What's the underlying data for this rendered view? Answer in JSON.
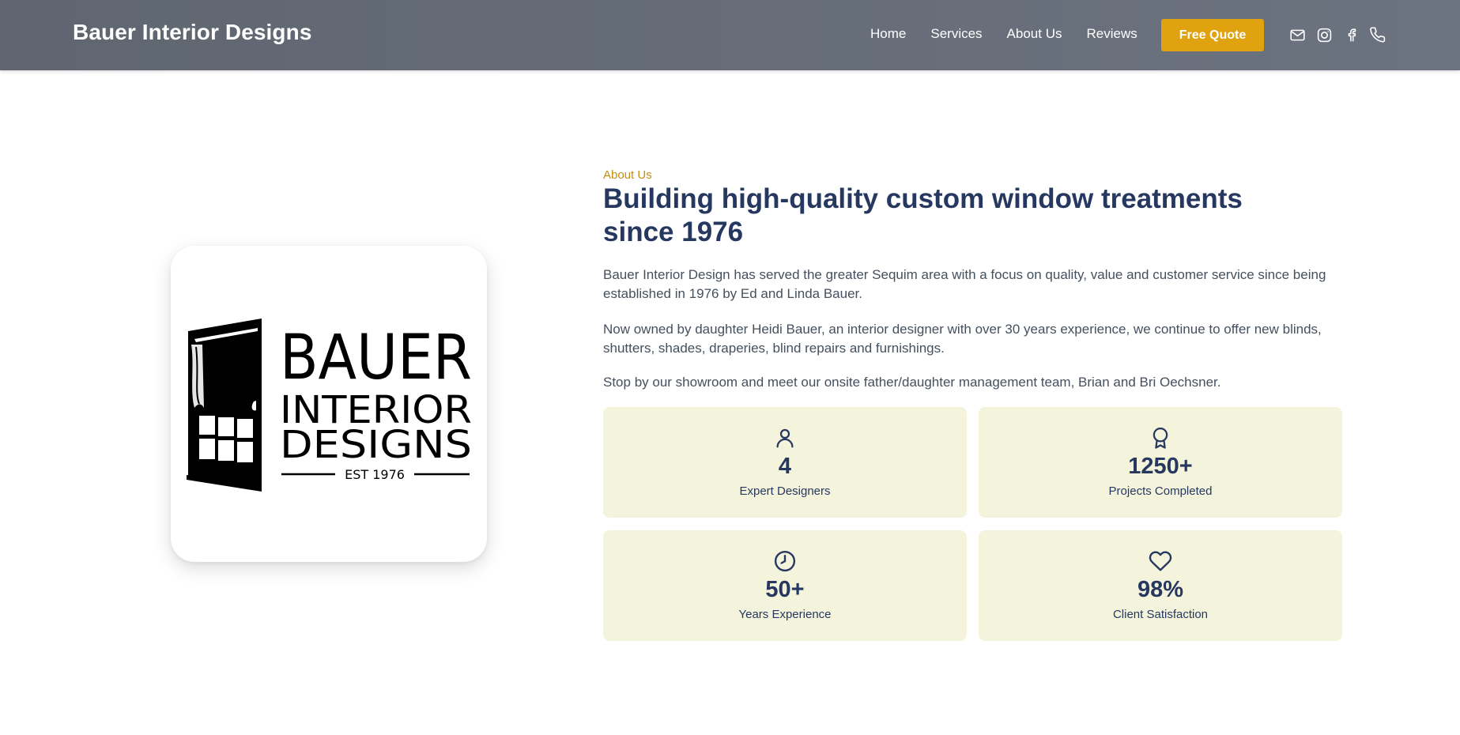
{
  "header": {
    "brand": "Bauer Interior Designs",
    "nav": [
      "Home",
      "Services",
      "About Us",
      "Reviews"
    ],
    "quote_button": "Free Quote",
    "icons": [
      "mail-icon",
      "instagram-icon",
      "facebook-icon",
      "phone-icon"
    ],
    "colors": {
      "bar": "#656c77",
      "accent": "#e0a20f"
    }
  },
  "logo": {
    "word1": "BAUER",
    "word2": "INTERIOR",
    "word3": "DESIGNS",
    "est": "EST 1976"
  },
  "about": {
    "eyebrow": "About Us",
    "heading": "Building high-quality custom window treatments since 1976",
    "paragraphs": [
      "Bauer Interior Design has served the greater Sequim area with a focus on quality, value and customer service since being established in 1976 by Ed and Linda Bauer.",
      "Now owned by daughter Heidi Bauer, an interior designer with over 30 years experience, we continue to offer new blinds, shutters, shades, draperies, blind repairs and furnishings.",
      "Stop by our showroom and meet our onsite father/daughter management team, Brian and Bri Oechsner."
    ],
    "colors": {
      "eyebrow": "#c38f13",
      "heading": "#26385f",
      "stat_bg": "#f4f3dc"
    }
  },
  "stats": [
    {
      "icon": "user-icon",
      "value": "4",
      "label": "Expert Designers"
    },
    {
      "icon": "award-icon",
      "value": "1250+",
      "label": "Projects Completed"
    },
    {
      "icon": "clock-icon",
      "value": "50+",
      "label": "Years Experience"
    },
    {
      "icon": "heart-icon",
      "value": "98%",
      "label": "Client Satisfaction"
    }
  ]
}
